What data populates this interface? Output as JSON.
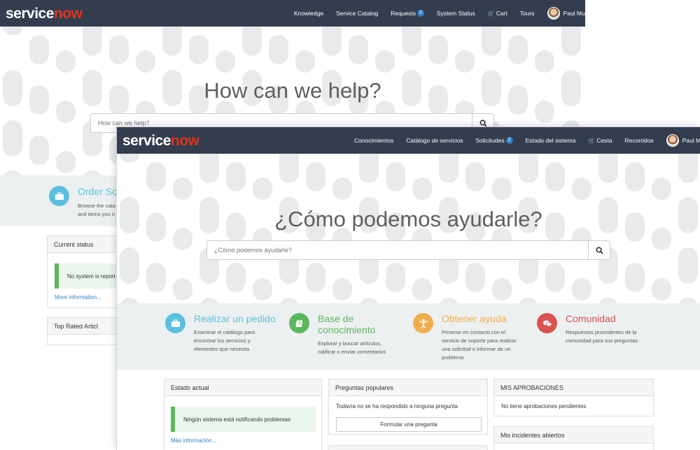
{
  "colors": {
    "header_bg": "#333d4e",
    "brand_red": "#e3321e",
    "badge": "#2f7ec7",
    "band": "#edf0f1",
    "link": "#2f7ec7",
    "success": "#5cb85c"
  },
  "en": {
    "brand": {
      "a": "service",
      "b": "now"
    },
    "nav": {
      "knowledge": "Knowledge",
      "catalog": "Service Catalog",
      "requests": "Requests",
      "requests_badge": "2",
      "status": "System Status",
      "cart": "Cart",
      "tours": "Tours",
      "user": "Paul Murphy"
    },
    "hero": {
      "title": "How can we help?",
      "placeholder": "How can we help?"
    },
    "order": {
      "title": "Order So",
      "desc1": "Browse the cata",
      "desc2": "and items you n"
    },
    "current_status": {
      "title": "Current status",
      "alert": "No system is report",
      "link": "More information..."
    },
    "next_panel": {
      "title": "Top Rated Articl"
    }
  },
  "es": {
    "brand": {
      "a": "service",
      "b": "now"
    },
    "nav": {
      "knowledge": "Conocimientos",
      "catalog": "Catálogo de servicios",
      "requests": "Solicitudes",
      "requests_badge": "2",
      "status": "Estado del sistema",
      "cart": "Cesta",
      "tours": "Recorridos",
      "user": "Paul Murphy"
    },
    "hero": {
      "title": "¿Cómo podemos ayudarle?",
      "placeholder": "¿Cómo podemos ayudarle?"
    },
    "features": [
      {
        "title": "Realizar un pedido",
        "desc": [
          "Examinar el catálogo para",
          "encontrar los servicios y",
          "elementos que necesita"
        ],
        "color": "#5bc0de",
        "icon": "briefcase-icon"
      },
      {
        "title": "Base de conocimiento",
        "desc": [
          "Explorar y buscar artículos,",
          "calificar o enviar comentarios"
        ],
        "color": "#5cb85c",
        "icon": "book-icon"
      },
      {
        "title": "Obtener ayuda",
        "desc": [
          "Ponerse en contacto con el",
          "servicio de soporte para realizar",
          "una solicitud o informar de un",
          "problema"
        ],
        "color": "#f0ad4e",
        "icon": "person-help-icon"
      },
      {
        "title": "Comunidad",
        "desc": [
          "Respuestas procedentes de la",
          "comunidad para sus preguntas"
        ],
        "color": "#d9534f",
        "icon": "chat-bubbles-icon"
      }
    ],
    "estado": {
      "title": "Estado actual",
      "alert": "Ningún sistema está notificando problemas",
      "link": "Más información..."
    },
    "preguntas": {
      "title": "Preguntas populares",
      "text": "Todavía no se ha respondido a ninguna pregunta",
      "button": "Formular una pregunta"
    },
    "aprobaciones": {
      "title": "MIS APROBACIONES",
      "text": "No tiene aprobaciones pendientes"
    },
    "incidentes": {
      "title": "Mis incidentes abiertos"
    }
  }
}
